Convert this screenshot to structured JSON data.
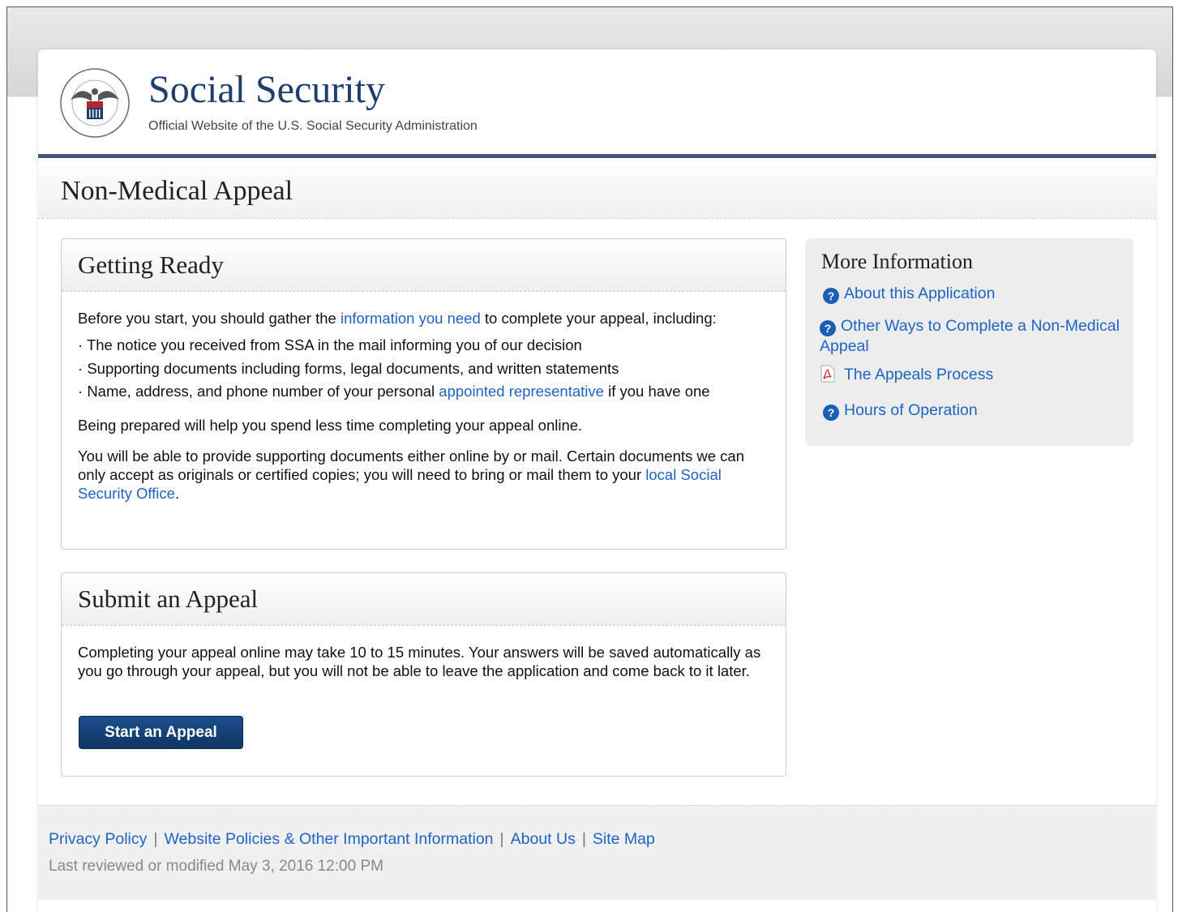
{
  "header": {
    "title": "Social Security",
    "subtitle": "Official Website of the U.S. Social Security Administration"
  },
  "page": {
    "title": "Non-Medical Appeal"
  },
  "getting_ready": {
    "title": "Getting Ready",
    "intro_before": "Before you start, you should gather the ",
    "intro_link": "information you need",
    "intro_after": " to complete your appeal, including:",
    "bullets": [
      "The notice you received from SSA in the mail informing you of our decision",
      "Supporting documents including forms, legal documents, and written statements"
    ],
    "bullet3_before": "Name, address, and phone number of your personal ",
    "bullet3_link": "appointed representative",
    "bullet3_after": " if you have one",
    "prepared": "Being prepared will help you spend less time completing your appeal online.",
    "docs_text": "You will be able to provide supporting documents either online by or mail. Certain documents we can only accept as originals or certified copies; you will need to bring or mail them to your ",
    "docs_link": "local Social Security Office",
    "docs_end": "."
  },
  "submit": {
    "title": "Submit an Appeal",
    "text": "Completing your appeal online may take 10 to 15 minutes. Your answers will be saved automatically as you go through your appeal, but you will not be able to leave the application and come back to it later.",
    "button_label": "Start an Appeal"
  },
  "more_info": {
    "title": "More Information",
    "links": [
      {
        "label": "About this Application",
        "icon": "help-circle-icon"
      },
      {
        "label": "Other Ways to Complete a Non-Medical Appeal",
        "icon": "help-circle-icon"
      },
      {
        "label": "The Appeals Process",
        "icon": "pdf-icon"
      },
      {
        "label": "Hours of Operation",
        "icon": "help-circle-icon"
      }
    ]
  },
  "footer": {
    "links": [
      "Privacy Policy",
      "Website Policies & Other Important Information",
      "About Us",
      "Site Map"
    ],
    "separator": "|",
    "last_modified": "Last reviewed or modified May 3, 2016 12:00 PM"
  },
  "colors": {
    "brand_navy": "#1e3e6e",
    "header_rule": "#48597a",
    "link": "#1d64c4",
    "button": "#0f3563"
  }
}
